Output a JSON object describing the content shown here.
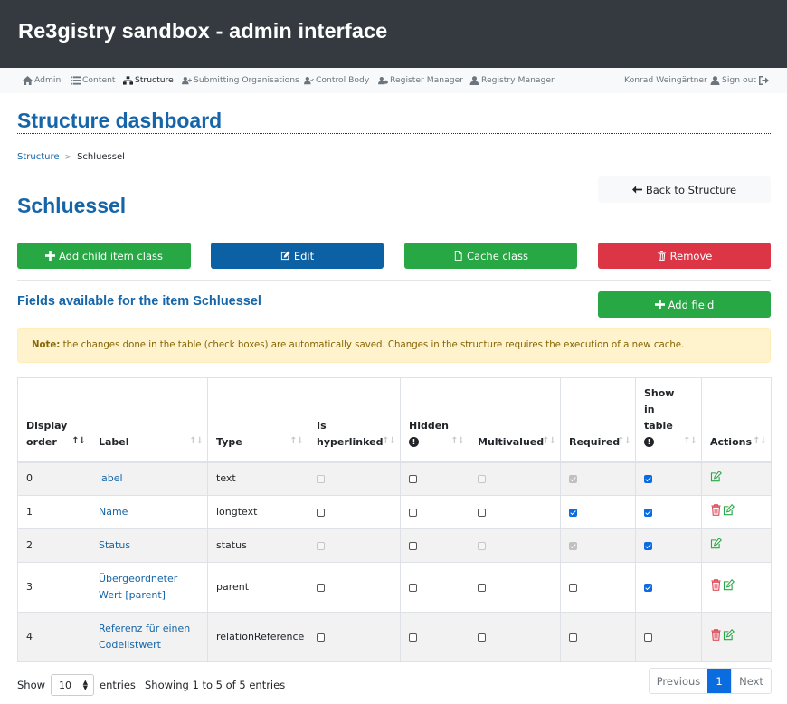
{
  "app": {
    "title": "Re3gistry sandbox - admin interface"
  },
  "nav": {
    "admin": "Admin",
    "content": "Content",
    "structure": "Structure",
    "submitting": "Submitting Organisations",
    "control": "Control Body",
    "register_manager": "Register Manager",
    "registry_manager": "Registry Manager",
    "user": "Konrad Weingärtner",
    "signout": "Sign out"
  },
  "page": {
    "title": "Structure dashboard"
  },
  "breadcrumb": {
    "parent": "Structure",
    "current": "Schluessel"
  },
  "section": {
    "title": "Schluessel"
  },
  "buttons": {
    "back": "Back to Structure",
    "add_child": "Add child item class",
    "edit": "Edit",
    "cache": "Cache class",
    "remove": "Remove",
    "add_field": "Add field"
  },
  "fields": {
    "title": "Fields available for the item Schluessel"
  },
  "note": {
    "label": "Note:",
    "text": " the changes done in the table (check boxes) are automatically saved. Changes in the structure requires the execution of a new cache."
  },
  "table": {
    "headers": {
      "order1": "Display",
      "order2": "order",
      "label": "Label",
      "type": "Type",
      "hyper1": "Is",
      "hyper2": "hyperlinked",
      "hidden": "Hidden",
      "multi": "Multivalued",
      "required": "Required",
      "show1": "Show",
      "show2": "in",
      "show3": "table",
      "actions": "Actions"
    },
    "rows": [
      {
        "order": "0",
        "label": "label",
        "type": "text"
      },
      {
        "order": "1",
        "label": "Name",
        "type": "longtext"
      },
      {
        "order": "2",
        "label": "Status",
        "type": "status"
      },
      {
        "order": "3",
        "label1": "Übergeordneter",
        "label2": "Wert [parent]",
        "type": "parent"
      },
      {
        "order": "4",
        "label1": "Referenz für einen",
        "label2": "Codelistwert",
        "type": "relationReference"
      }
    ]
  },
  "footer": {
    "show": "Show",
    "entries_value": "10",
    "entries": "entries",
    "info": "Showing 1 to 5 of 5 entries",
    "previous": "Previous",
    "page": "1",
    "next": "Next"
  },
  "colors": {
    "topbar": "#343a40",
    "title_blue": "#1565a8",
    "green": "#28a745",
    "blue": "#0b61a4",
    "red": "#dc3545",
    "note_bg": "#fff3cd"
  }
}
